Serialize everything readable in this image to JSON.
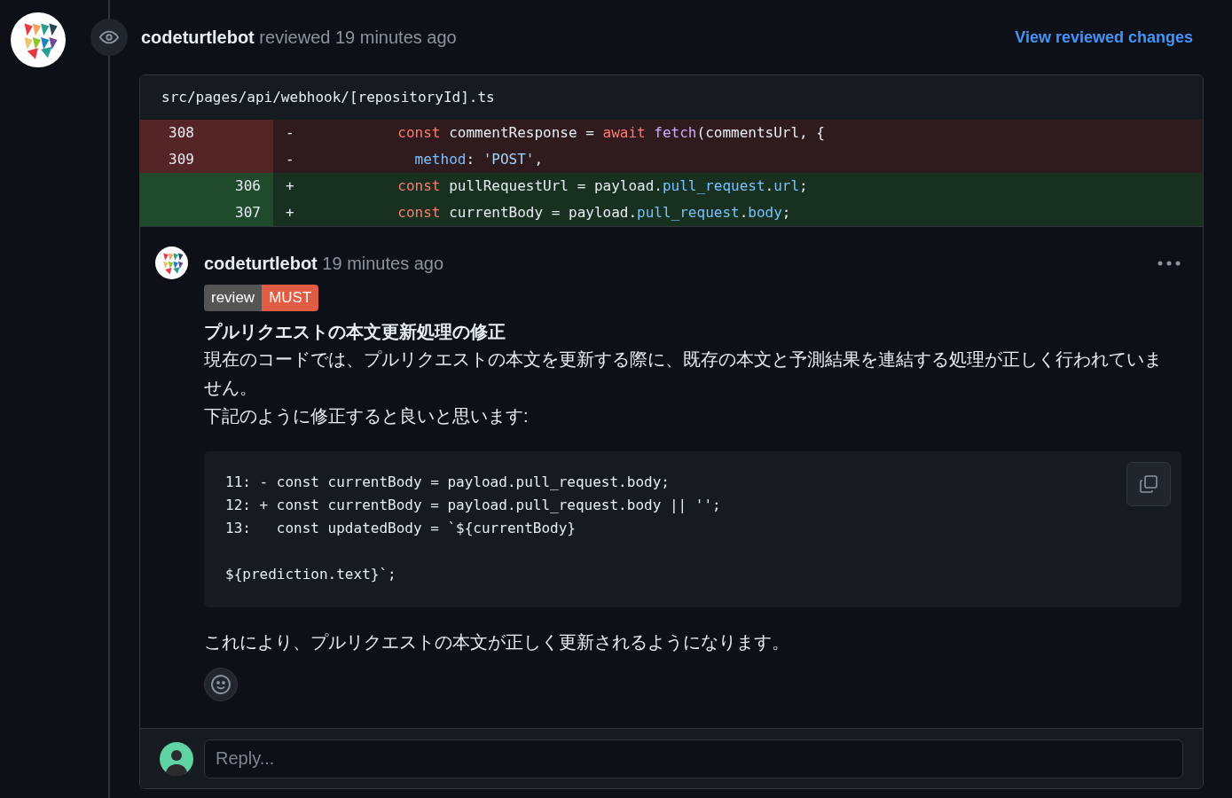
{
  "review_header": {
    "author": "codeturtlebot",
    "action": "reviewed 19 minutes ago",
    "link": "View reviewed changes"
  },
  "file": {
    "path": "src/pages/api/webhook/[repositoryId].ts",
    "diff": [
      {
        "kind": "del",
        "old": "308",
        "sign": "-",
        "tokens": [
          {
            "kind": "kw",
            "s": "          const"
          },
          {
            "kind": "plain",
            "s": " commentResponse = "
          },
          {
            "kind": "kw",
            "s": "await "
          },
          {
            "kind": "fn",
            "s": "fetch"
          },
          {
            "kind": "plain",
            "s": "(commentsUrl, {"
          }
        ]
      },
      {
        "kind": "del",
        "old": "309",
        "sign": "-",
        "tokens": [
          {
            "kind": "prop",
            "s": "            method"
          },
          {
            "kind": "plain",
            "s": ": "
          },
          {
            "kind": "str",
            "s": "'POST'"
          },
          {
            "kind": "plain",
            "s": ","
          }
        ]
      },
      {
        "kind": "add",
        "new": "306",
        "sign": "+",
        "tokens": [
          {
            "kind": "kw",
            "s": "          const"
          },
          {
            "kind": "plain",
            "s": " pullRequestUrl = payload."
          },
          {
            "kind": "prop",
            "s": "pull_request"
          },
          {
            "kind": "plain",
            "s": "."
          },
          {
            "kind": "prop",
            "s": "url"
          },
          {
            "kind": "plain",
            "s": ";"
          }
        ]
      },
      {
        "kind": "add",
        "new": "307",
        "sign": "+",
        "tokens": [
          {
            "kind": "kw",
            "s": "          const"
          },
          {
            "kind": "plain",
            "s": " currentBody = payload."
          },
          {
            "kind": "prop",
            "s": "pull_request"
          },
          {
            "kind": "plain",
            "s": "."
          },
          {
            "kind": "prop",
            "s": "body"
          },
          {
            "kind": "plain",
            "s": ";"
          }
        ]
      }
    ]
  },
  "comment": {
    "author": "codeturtlebot",
    "time": "19 minutes ago",
    "labels": [
      {
        "text": "review",
        "color": "#555555"
      },
      {
        "text": "MUST",
        "color": "#e05d44"
      }
    ],
    "title": "プルリクエストの本文更新処理の修正",
    "paragraphs": [
      "現在のコードでは、プルリクエストの本文を更新する際に、既存の本文と予測結果を連結する処理が正しく行われていません。",
      "下記のように修正すると良いと思います:"
    ],
    "code": "11: - const currentBody = payload.pull_request.body;\n12: + const currentBody = payload.pull_request.body || '';\n13:   const updatedBody = `${currentBody}\n\n${prediction.text}`;",
    "closing": "これにより、プルリクエストの本文が正しく更新されるようになります。"
  },
  "reply": {
    "placeholder": "Reply..."
  }
}
